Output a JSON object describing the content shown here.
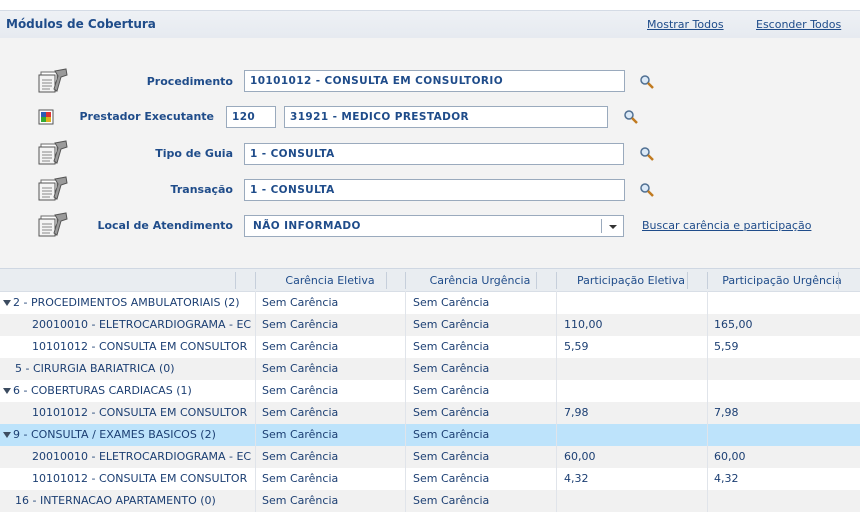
{
  "header": {
    "title": "Módulos de Cobertura",
    "show_all": "Mostrar Todos",
    "hide_all": "Esconder Todos"
  },
  "form": {
    "procedimento": {
      "label": "Procedimento",
      "value": "10101012 - CONSULTA EM CONSULTORIO"
    },
    "prestador": {
      "label": "Prestador Executante",
      "code": "120",
      "value": "31921 - MEDICO PRESTADOR"
    },
    "tipo_guia": {
      "label": "Tipo de Guia",
      "value": "1 - CONSULTA"
    },
    "transacao": {
      "label": "Transação",
      "value": "1 - CONSULTA"
    },
    "local": {
      "label": "Local de Atendimento",
      "value": "NÃO INFORMADO"
    },
    "search_link": "Buscar carência e participação"
  },
  "icons": {
    "form_row": "document-tool-icon",
    "prestador": "provider-card-icon",
    "lookup": "magnifier-icon",
    "dropdown": "chevron-down-icon",
    "tree_expanded": "triangle-down-icon"
  },
  "colors": {
    "text": "#1f4c8a",
    "selected_row": "#bde3fb",
    "alt_row": "#f1f1f1",
    "header_bg": "#e9edf1"
  },
  "grid": {
    "columns": [
      "Carência Eletiva",
      "Carência Urgência",
      "Participação Eletiva",
      "Participação Urgência"
    ],
    "rows": [
      {
        "name": "2 - PROCEDIMENTOS AMBULATORIAIS (2)",
        "expanded": true,
        "v1": "Sem Carência",
        "v2": "Sem Carência",
        "v3": "",
        "v4": ""
      },
      {
        "name": "20010010 - ELETROCARDIOGRAMA - EC",
        "v1": "Sem Carência",
        "v2": "Sem Carência",
        "v3": "110,00",
        "v4": "165,00"
      },
      {
        "name": "10101012 - CONSULTA EM CONSULTOR",
        "v1": "Sem Carência",
        "v2": "Sem Carência",
        "v3": "5,59",
        "v4": "5,59"
      },
      {
        "name": "5 - CIRURGIA BARIATRICA (0)",
        "v1": "Sem Carência",
        "v2": "Sem Carência",
        "v3": "",
        "v4": ""
      },
      {
        "name": "6 - COBERTURAS CARDIACAS (1)",
        "expanded": true,
        "v1": "Sem Carência",
        "v2": "Sem Carência",
        "v3": "",
        "v4": ""
      },
      {
        "name": "10101012 - CONSULTA EM CONSULTOR",
        "v1": "Sem Carência",
        "v2": "Sem Carência",
        "v3": "7,98",
        "v4": "7,98"
      },
      {
        "name": "9 - CONSULTA / EXAMES BASICOS (2)",
        "expanded": true,
        "selected": true,
        "v1": "Sem Carência",
        "v2": "Sem Carência",
        "v3": "",
        "v4": ""
      },
      {
        "name": "20010010 - ELETROCARDIOGRAMA - EC",
        "v1": "Sem Carência",
        "v2": "Sem Carência",
        "v3": "60,00",
        "v4": "60,00"
      },
      {
        "name": "10101012 - CONSULTA EM CONSULTOR",
        "v1": "Sem Carência",
        "v2": "Sem Carência",
        "v3": "4,32",
        "v4": "4,32"
      },
      {
        "name": "16 - INTERNACAO APARTAMENTO (0)",
        "v1": "Sem Carência",
        "v2": "Sem Carência",
        "v3": "",
        "v4": ""
      }
    ]
  }
}
